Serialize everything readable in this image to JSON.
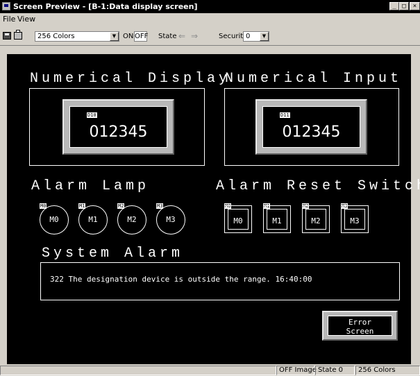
{
  "window": {
    "title": "Screen Preview - [B-1:Data display screen]"
  },
  "menu": {
    "file": "File",
    "view": "View"
  },
  "toolbar": {
    "colors_value": "256 Colors",
    "on_label": "ON",
    "off_label": "OFF",
    "state_label": "State",
    "security_label": "Security",
    "security_value": "0"
  },
  "screen": {
    "numerical_display": {
      "title": "Numerical Display",
      "device": "D10",
      "value": "012345"
    },
    "numerical_input": {
      "title": "Numerical Input",
      "device": "D11",
      "value": "012345"
    },
    "alarm_lamp": {
      "title": "Alarm Lamp",
      "lamps": [
        {
          "device": "M0",
          "label": "M0"
        },
        {
          "device": "M1",
          "label": "M1"
        },
        {
          "device": "M2",
          "label": "M2"
        },
        {
          "device": "M3",
          "label": "M3"
        }
      ]
    },
    "alarm_reset_switch": {
      "title": "Alarm Reset Switch",
      "switches": [
        {
          "device": "M0",
          "label": "M0"
        },
        {
          "device": "M1",
          "label": "M1"
        },
        {
          "device": "M2",
          "label": "M2"
        },
        {
          "device": "M3",
          "label": "M3"
        }
      ]
    },
    "system_alarm": {
      "title": "System Alarm",
      "message": "322 The designation device is outside the range.  16:40:00"
    },
    "error_button": {
      "line1": "Error",
      "line2": "Screen"
    }
  },
  "statusbar": {
    "image": "OFF Image",
    "state": "State 0",
    "colors": "256 Colors"
  }
}
